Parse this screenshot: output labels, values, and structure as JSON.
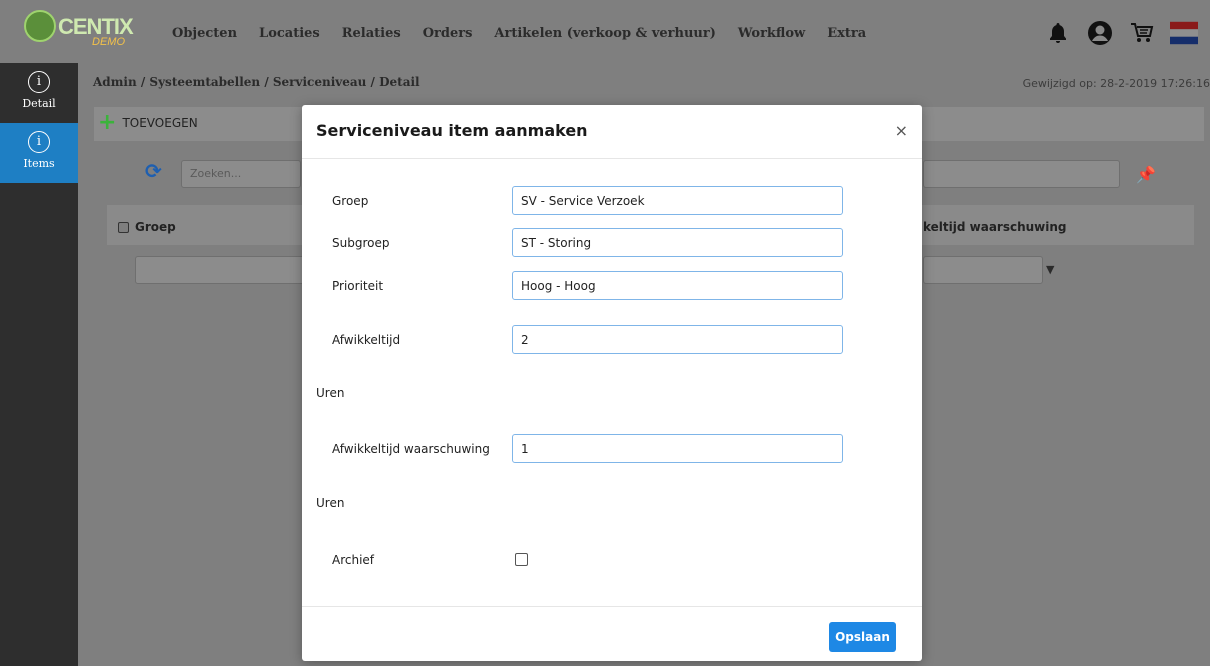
{
  "brand": {
    "logo_text": "CENTIX",
    "logo_sub": "DEMO"
  },
  "nav": {
    "items": [
      "Objecten",
      "Locaties",
      "Relaties",
      "Orders",
      "Artikelen (verkoop & verhuur)",
      "Workflow",
      "Extra"
    ],
    "icons": [
      "bell-icon",
      "user-avatar-icon",
      "cart-icon",
      "flag-nl-icon"
    ]
  },
  "sidebar": {
    "items": [
      {
        "label": "Detail",
        "icon": "info-icon"
      },
      {
        "label": "Items",
        "icon": "info-icon"
      }
    ]
  },
  "page": {
    "breadcrumb": "Admin / Systeemtabellen / Serviceniveau / Detail",
    "modified": "Gewijzigd op: 28-2-2019 17:26:16",
    "add_label": "TOEVOEGEN",
    "search_placeholder": "Zoeken...",
    "grid_col_group": "Groep",
    "grid_col_right": "keltijd waarschuwing"
  },
  "modal": {
    "title": "Serviceniveau item aanmaken",
    "close": "×",
    "fields": {
      "group_label": "Groep",
      "group_value": "SV - Service Verzoek",
      "subgroup_label": "Subgroep",
      "subgroup_value": "ST - Storing",
      "priority_label": "Prioriteit",
      "priority_value": "Hoog - Hoog",
      "time_label": "Afwikkeltijd",
      "time_value": "2",
      "time_unit": "Uren",
      "warn_label": "Afwikkeltijd waarschuwing",
      "warn_value": "1",
      "warn_unit": "Uren",
      "archive_label": "Archief"
    },
    "save_label": "Opslaan"
  },
  "colors": {
    "overlay": "#7f7f7f",
    "sidebar": "#2e2e2e",
    "active": "#1e7fc4",
    "primary": "#1e88e5",
    "input_border": "#7fb5e8"
  }
}
